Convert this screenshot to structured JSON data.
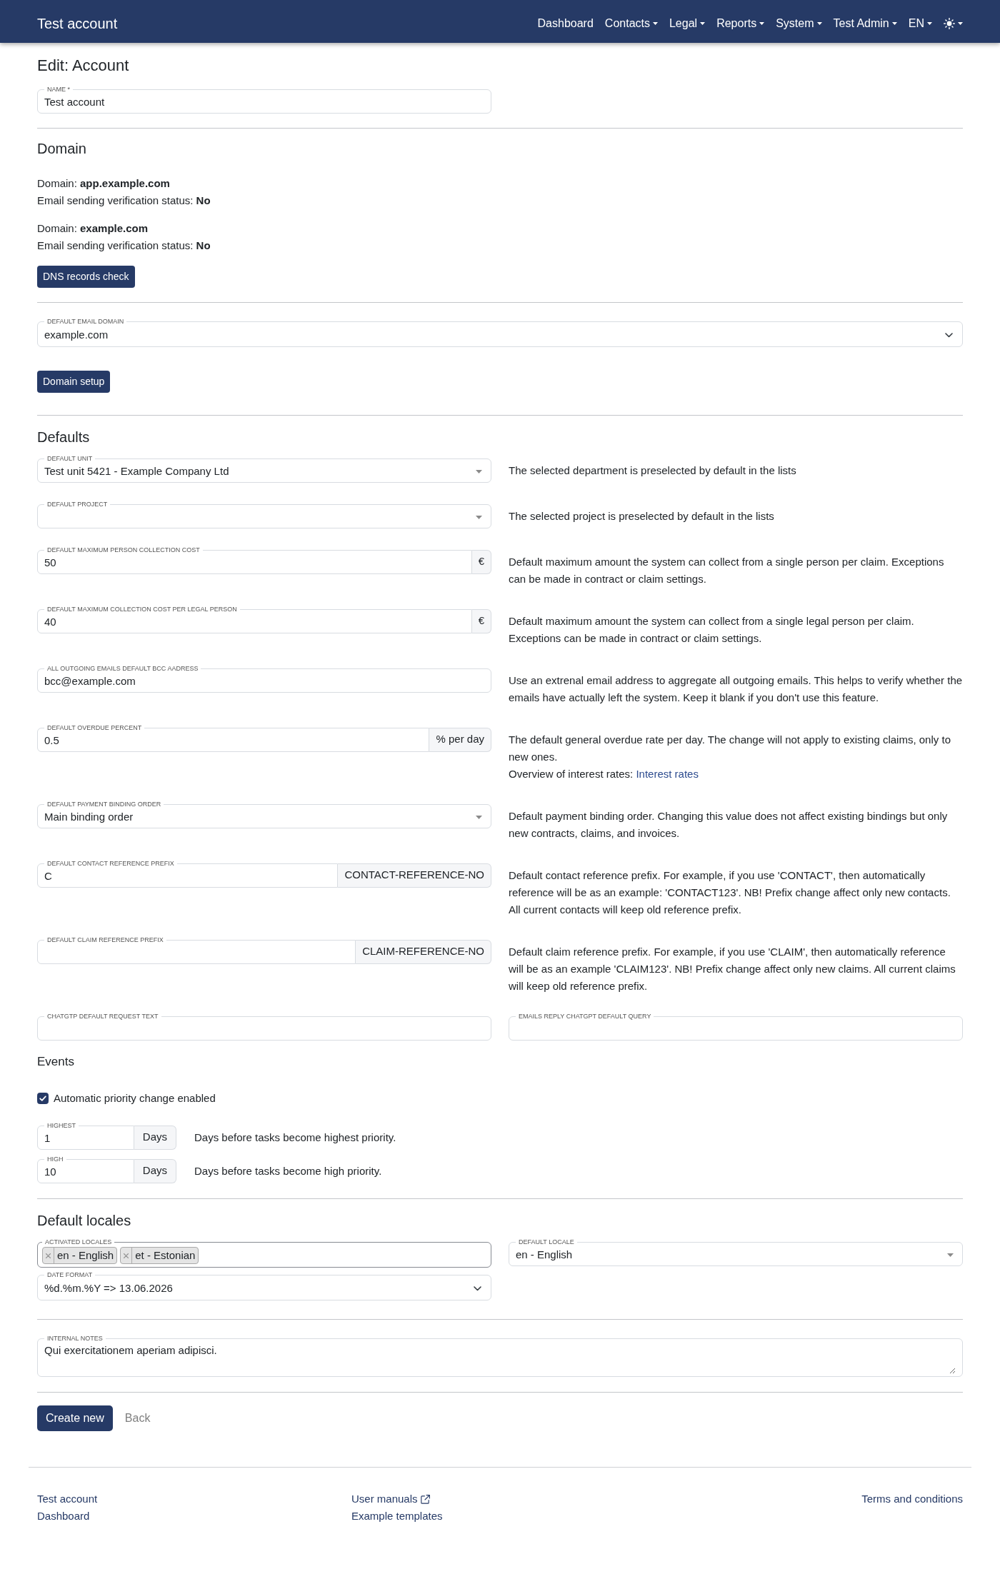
{
  "navbar": {
    "brand": "Test account",
    "items": [
      {
        "kind": "link",
        "label": "Dashboard",
        "dropdown": false
      },
      {
        "kind": "link",
        "label": "Contacts",
        "dropdown": true
      },
      {
        "kind": "link",
        "label": "Legal",
        "dropdown": true
      },
      {
        "kind": "link",
        "label": "Reports",
        "dropdown": true
      },
      {
        "kind": "link",
        "label": "System",
        "dropdown": true
      },
      {
        "kind": "link",
        "label": "Test Admin",
        "dropdown": true
      },
      {
        "kind": "link",
        "label": "EN",
        "dropdown": true
      },
      {
        "kind": "theme",
        "dropdown": true
      }
    ]
  },
  "page_title": "Edit: Account",
  "name_field": {
    "kind": "input",
    "label": "NAME *",
    "value": "Test account"
  },
  "domain": {
    "heading": "Domain",
    "entries": [
      {
        "domain": "Domain: **app.example.com**",
        "status": "Email sending verification status: **No**"
      },
      {
        "domain": "Domain: **example.com**",
        "status": "Email sending verification status: **No**"
      }
    ],
    "check_button": "DNS records check",
    "email_domain": {
      "kind": "native-select",
      "label": "DEFAULT EMAIL DOMAIN",
      "value": "example.com"
    },
    "setup_button": "Domain setup"
  },
  "defaults": {
    "heading": "Defaults",
    "rows": [
      {
        "kind": "select",
        "label": "DEFAULT UNIT",
        "value": "Test unit 5421 - Example Company Ltd",
        "description": "The selected department is preselected by default in the lists"
      },
      {
        "kind": "select",
        "label": "DEFAULT PROJECT",
        "description": "The selected project is preselected by default in the lists"
      },
      {
        "kind": "addon",
        "label": "DEFAULT MAXIMUM PERSON COLLECTION COST",
        "value": "50",
        "addon": "€",
        "description": "Default maximum amount the system can collect from a single person per claim. Exceptions can be made in contract or claim settings."
      },
      {
        "kind": "addon",
        "label": "DEFAULT MAXIMUM COLLECTION COST PER LEGAL PERSON",
        "value": "40",
        "addon": "€",
        "description": "Default maximum amount the system can collect from a single legal person per claim. Exceptions can be made in contract or claim settings."
      },
      {
        "kind": "input",
        "label": "ALL OUTGOING EMAILS DEFAULT BCC AADRESS",
        "value": "bcc@example.com",
        "description": "Use an extrenal email address to aggregate all outgoing emails. This helps to verify whether the emails have actually left the system. Keep it blank if you don't use this feature."
      },
      {
        "kind": "addon",
        "label": "DEFAULT OVERDUE PERCENT",
        "value": "0.5",
        "addon": "% per day",
        "description": "The default general overdue rate per day. The change will not apply to existing claims, only to new ones.",
        "note": {
          "text": "Overview of interest rates:",
          "link": "Interest rates"
        }
      },
      {
        "kind": "select",
        "label": "DEFAULT PAYMENT BINDING ORDER",
        "value": "Main binding order",
        "description": "Default payment binding order. Changing this value does not affect existing bindings but only new contracts, claims, and invoices."
      },
      {
        "kind": "addon",
        "label": "DEFAULT CONTACT REFERENCE PREFIX",
        "value": "C",
        "addon": "CONTACT-REFERENCE-NO",
        "description": "Default contact reference prefix. For example, if you use 'CONTACT', then automatically reference will be as an example: 'CONTACT123'. NB! Prefix change affect only new contacts. All current contacts will keep old reference prefix."
      },
      {
        "kind": "addon",
        "label": "DEFAULT CLAIM REFERENCE PREFIX",
        "addon": "CLAIM-REFERENCE-NO",
        "description": "Default claim reference prefix. For example, if you use 'CLAIM', then automatically reference will be as an example 'CLAIM123'. NB! Prefix change affect only new claims. All current claims will keep old reference prefix."
      }
    ],
    "chatgpt_fields": [
      {
        "kind": "input",
        "label": "CHATGTP DEFAULT REQUEST TEXT"
      },
      {
        "kind": "input",
        "label": "EMAILS REPLY CHATGPT DEFAULT QUERY"
      }
    ]
  },
  "events": {
    "heading": "Events",
    "checkbox": {
      "label": "Automatic priority change enabled",
      "checked": true
    },
    "priorities": [
      {
        "kind": "addon",
        "label": "HIGHEST",
        "value": "1",
        "addon": "Days",
        "description": "Days before tasks become highest priority."
      },
      {
        "kind": "addon",
        "label": "HIGH",
        "value": "10",
        "addon": "Days",
        "description": "Days before tasks become high priority."
      }
    ]
  },
  "locales": {
    "heading": "Default locales",
    "activated": {
      "kind": "multi-select",
      "label": "ACTIVATED LOCALES",
      "focused": true,
      "tags": [
        "en - English",
        "et - Estonian"
      ]
    },
    "default_locale": {
      "kind": "select",
      "label": "DEFAULT LOCALE",
      "value": "en - English"
    },
    "date_format": {
      "kind": "native-select",
      "label": "DATE FORMAT",
      "value": "%d.%m.%Y => 13.06.2026"
    }
  },
  "internal_notes": {
    "kind": "textarea",
    "label": "INTERNAL NOTES",
    "value": "Qui exercitationem aperiam adipisci."
  },
  "actions": {
    "submit": "Create new",
    "back": "Back"
  },
  "footer": {
    "columns": [
      {
        "items": [
          {
            "label": "Test account",
            "external": false
          },
          {
            "label": "Dashboard",
            "external": false
          }
        ]
      },
      {
        "items": [
          {
            "label": "User manuals",
            "external": true
          },
          {
            "label": "Example templates",
            "external": false
          }
        ]
      },
      {
        "items": [
          {
            "label": "Terms and conditions",
            "external": false
          }
        ]
      }
    ]
  }
}
